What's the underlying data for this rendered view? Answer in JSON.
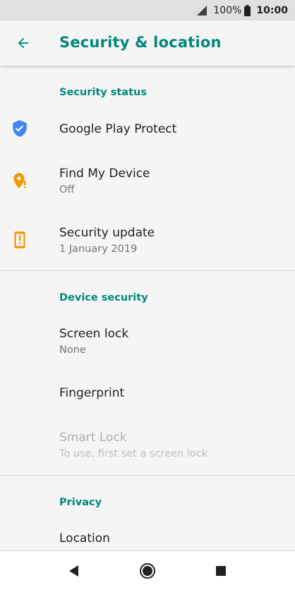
{
  "status_bar": {
    "battery": "100%",
    "time": "10:00"
  },
  "app_bar": {
    "title": "Security & location",
    "back_icon": "arrow-back-icon"
  },
  "colors": {
    "accent": "#00897b",
    "shield_blue": "#4285f4",
    "warning_orange": "#f29900"
  },
  "sections": {
    "security_status": {
      "header": "Security status",
      "items": [
        {
          "title": "Google Play Protect",
          "summary": "",
          "icon": "shield-check-icon"
        },
        {
          "title": "Find My Device",
          "summary": "Off",
          "icon": "location-alert-icon"
        },
        {
          "title": "Security update",
          "summary": "1 January 2019",
          "icon": "phone-alert-icon"
        }
      ]
    },
    "device_security": {
      "header": "Device security",
      "items": [
        {
          "title": "Screen lock",
          "summary": "None"
        },
        {
          "title": "Fingerprint",
          "summary": ""
        },
        {
          "title": "Smart Lock",
          "summary": "To use, first set a screen lock",
          "disabled": true
        }
      ]
    },
    "privacy": {
      "header": "Privacy",
      "items": [
        {
          "title": "Location",
          "summary": ""
        }
      ]
    }
  },
  "nav_bar": {
    "back": "nav-back-icon",
    "home": "nav-home-icon",
    "recents": "nav-recents-icon"
  }
}
